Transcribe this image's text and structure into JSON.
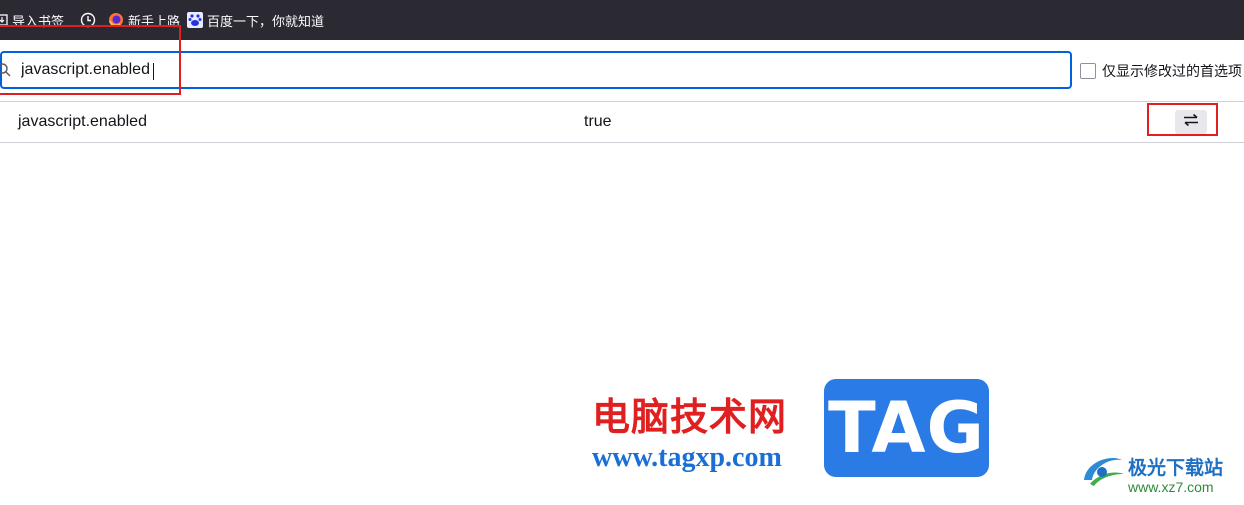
{
  "bookmarks": [
    {
      "label": "导入书签",
      "icon": "import-icon"
    },
    {
      "label": "",
      "icon": "history-icon"
    },
    {
      "label": "新手上路",
      "icon": "firefox-icon"
    },
    {
      "label": "百度一下，你就知道",
      "icon": "baidu-icon"
    }
  ],
  "search": {
    "value": "javascript.enabled",
    "icon": "search-icon"
  },
  "filter": {
    "modified_only_label": "仅显示修改过的首选项",
    "checked": false
  },
  "prefs": [
    {
      "name": "javascript.enabled",
      "value": "true",
      "action_icon": "toggle-icon"
    }
  ],
  "highlight_color": "#e02020",
  "accent_color": "#0061e0",
  "watermarks": {
    "site_title": "电脑技术网",
    "site_url": "www.tagxp.com",
    "tag_logo": "TAG",
    "xz7_name": "极光下载站",
    "xz7_url": "www.xz7.com"
  }
}
